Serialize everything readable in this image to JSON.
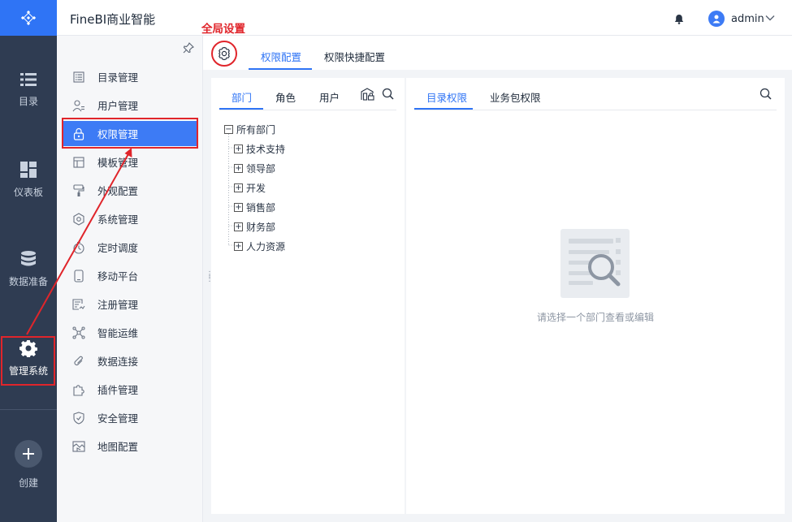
{
  "header": {
    "app_title": "FineBI商业智能",
    "user_name": "admin"
  },
  "rail": {
    "items": [
      {
        "label": "目录"
      },
      {
        "label": "仪表板"
      },
      {
        "label": "数据准备"
      },
      {
        "label": "管理系统"
      },
      {
        "label": "创建"
      }
    ]
  },
  "sidebar": {
    "items": [
      {
        "label": "目录管理"
      },
      {
        "label": "用户管理"
      },
      {
        "label": "权限管理"
      },
      {
        "label": "模板管理"
      },
      {
        "label": "外观配置"
      },
      {
        "label": "系统管理"
      },
      {
        "label": "定时调度"
      },
      {
        "label": "移动平台"
      },
      {
        "label": "注册管理"
      },
      {
        "label": "智能运维"
      },
      {
        "label": "数据连接"
      },
      {
        "label": "插件管理"
      },
      {
        "label": "安全管理"
      },
      {
        "label": "地图配置"
      }
    ]
  },
  "annotation": {
    "global_settings": "全局设置"
  },
  "main": {
    "tabs": [
      {
        "label": "权限配置"
      },
      {
        "label": "权限快捷配置"
      }
    ]
  },
  "left_panel": {
    "tabs": [
      {
        "label": "部门"
      },
      {
        "label": "角色"
      },
      {
        "label": "用户"
      }
    ],
    "tree_root": "所有部门",
    "tree_children": [
      "技术支持",
      "领导部",
      "开发",
      "销售部",
      "财务部",
      "人力资源"
    ]
  },
  "right_panel": {
    "tabs": [
      {
        "label": "目录权限"
      },
      {
        "label": "业务包权限"
      }
    ],
    "empty_hint": "请选择一个部门查看或编辑"
  },
  "colors": {
    "accent": "#2f74f5",
    "rail_bg": "#2f3c52",
    "annotation": "#e0252b"
  }
}
